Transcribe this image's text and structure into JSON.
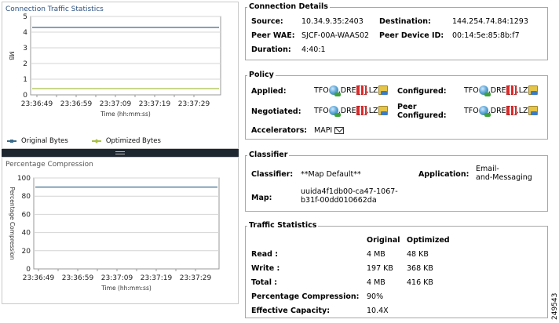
{
  "traffic_chart": {
    "title": "Connection Traffic Statistics",
    "ylabel": "MB",
    "xlabel": "Time (hh:mm:ss)",
    "legend": [
      {
        "label": "Original Bytes",
        "color": "#3a6b8a"
      },
      {
        "label": "Optimized Bytes",
        "color": "#a9bf45"
      }
    ]
  },
  "compression_chart": {
    "title": "Percentage Compression",
    "ylabel": "Percentage Compression",
    "xlabel": "Time (hh:mm:ss)"
  },
  "chart_data": [
    {
      "type": "line",
      "title": "Connection Traffic Statistics",
      "xlabel": "Time (hh:mm:ss)",
      "ylabel": "MB",
      "x": [
        "23:36:49",
        "23:36:59",
        "23:37:09",
        "23:37:19",
        "23:37:29"
      ],
      "ylim": [
        0,
        5
      ],
      "yticks": [
        0,
        1,
        2,
        3,
        4,
        5
      ],
      "series": [
        {
          "name": "Original Bytes",
          "color": "#3a6b8a",
          "values": [
            4.3,
            4.3,
            4.3,
            4.3,
            4.3
          ]
        },
        {
          "name": "Optimized Bytes",
          "color": "#a9bf45",
          "values": [
            0.4,
            0.4,
            0.4,
            0.4,
            0.4
          ]
        }
      ],
      "grid": "horizontal"
    },
    {
      "type": "line",
      "title": "Percentage Compression",
      "xlabel": "Time (hh:mm:ss)",
      "ylabel": "Percentage Compression",
      "x": [
        "23:36:49",
        "23:36:59",
        "23:37:09",
        "23:37:19",
        "23:37:29"
      ],
      "ylim": [
        0,
        100
      ],
      "yticks": [
        0,
        20,
        40,
        60,
        80,
        100
      ],
      "series": [
        {
          "color": "#3a6b8a",
          "values": [
            90,
            90,
            90,
            90,
            90
          ]
        }
      ],
      "grid": "horizontal"
    }
  ],
  "connection": {
    "title": "Connection Details",
    "source_label": "Source:",
    "source": "10.34.9.35:2403",
    "destination_label": "Destination:",
    "destination": "144.254.74.84:1293",
    "peer_waae_label": "Peer WAE:",
    "peer_waae": "SJCF-00A-WAAS02",
    "peer_id_label": "Peer Device ID:",
    "peer_id": "00:14:5e:85:8b:f7",
    "duration_label": "Duration:",
    "duration": "4:40:1"
  },
  "policy": {
    "title": "Policy",
    "applied_label": "Applied:",
    "configured_label": "Configured:",
    "negotiated_label": "Negotiated:",
    "peer_configured_label": "Peer\nConfigured:",
    "tfo": "TFO",
    "dre": ",DRE",
    "lz": ",LZ",
    "accelerators_label": "Accelerators:",
    "accelerators": "MAPI"
  },
  "classifier": {
    "title": "Classifier",
    "classifier_label": "Classifier:",
    "classifier": "**Map Default**",
    "application_label": "Application:",
    "application": "Email-\nand-Messaging",
    "map_label": "Map:",
    "map": "uuida4f1db00-ca47-1067-\nb31f-00dd010662da"
  },
  "traffic_stats": {
    "title": "Traffic Statistics",
    "col_original": "Original",
    "col_optimized": "Optimized",
    "rows": [
      {
        "label": "Read :",
        "original": "4 MB",
        "optimized": "48 KB"
      },
      {
        "label": "Write :",
        "original": "197 KB",
        "optimized": "368 KB"
      },
      {
        "label": "Total :",
        "original": "4 MB",
        "optimized": "416 KB"
      }
    ],
    "pct_label": "Percentage Compression:",
    "pct": "90%",
    "capacity_label": "Effective Capacity:",
    "capacity": "10.4X"
  },
  "figure_number": "249543"
}
